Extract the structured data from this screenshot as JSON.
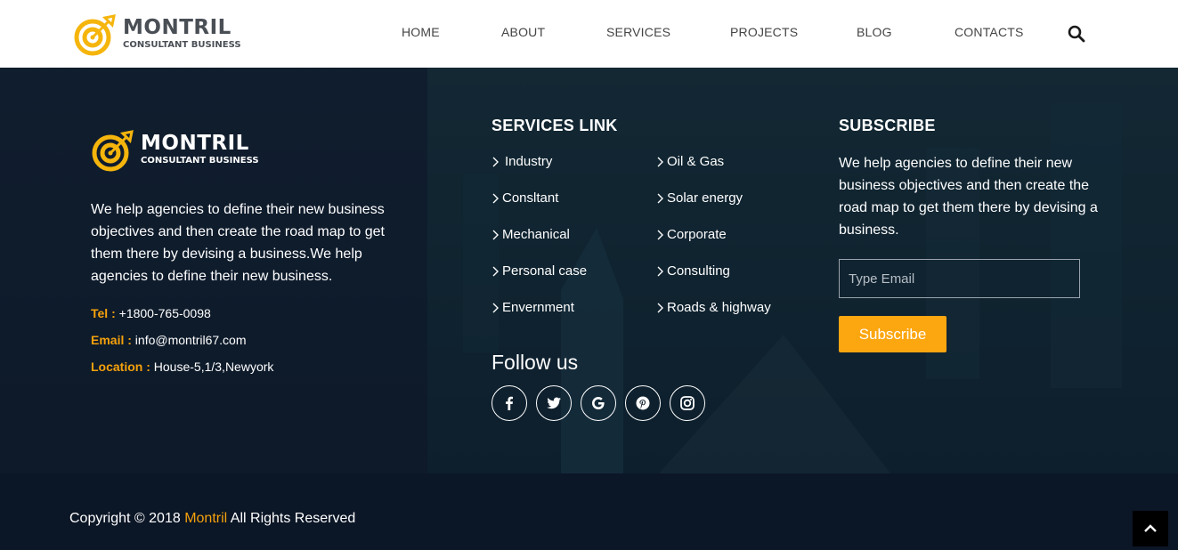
{
  "brand": {
    "name": "MONTRIL",
    "tagline": "CONSULTANT BUSINESS",
    "accent_color": "#f5a10c",
    "logo_icon": "target-arrow-icon"
  },
  "nav": {
    "items": [
      "HOME",
      "ABOUT",
      "SERVICES",
      "PROJECTS",
      "BLOG",
      "CONTACTS"
    ],
    "search_icon": "search-icon"
  },
  "about": {
    "text": "We help agencies to define their new business objectives and then create the road map to get them there by devising a business.We help agencies to define their new business.",
    "contacts": [
      {
        "key": "Tel :",
        "value": "+1800-765-0098"
      },
      {
        "key": "Email :",
        "value": "info@montril67.com"
      },
      {
        "key": "Location :",
        "value": "House-5,1/3,Newyork"
      }
    ]
  },
  "services": {
    "title": "SERVICES LINK",
    "left": [
      "Industry",
      "Consltant",
      "Mechanical",
      "Personal case",
      "Envernment"
    ],
    "right": [
      "Oil & Gas",
      "Solar energy",
      "Corporate",
      "Consulting",
      "Roads & highway"
    ],
    "bullet_icon": "chevron-right-icon"
  },
  "follow": {
    "title": "Follow us",
    "icons": [
      "facebook-icon",
      "twitter-icon",
      "google-icon",
      "pinterest-icon",
      "instagram-icon"
    ]
  },
  "subscribe": {
    "title": "SUBSCRIBE",
    "text": "We help agencies to define their new business objectives and then create the road map to get them there by devising a business.",
    "email_placeholder": "Type Email",
    "email_value": "",
    "button_label": "Subscribe",
    "button_color": "#fca610"
  },
  "footer": {
    "copyright_prefix": "Copyright © 2018",
    "copyright_brand": "Montril",
    "copyright_suffix": "All Rights Reserved",
    "to_top_icon": "chevron-up-icon"
  }
}
